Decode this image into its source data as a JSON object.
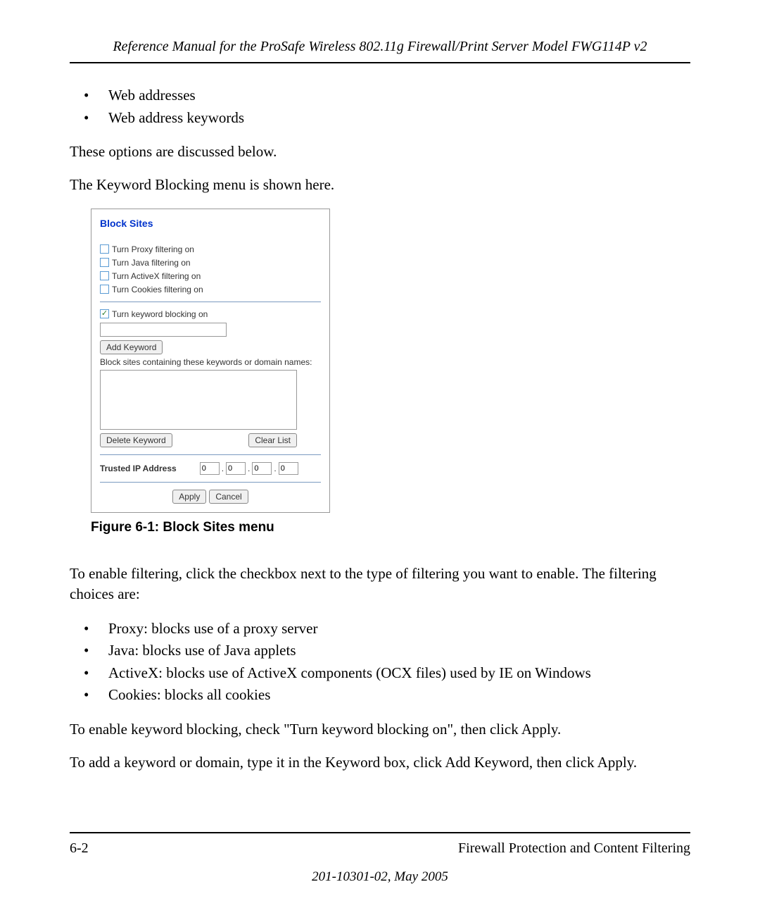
{
  "header": {
    "title": "Reference Manual for the ProSafe Wireless 802.11g  Firewall/Print Server Model FWG114P v2"
  },
  "list1": {
    "items": [
      "Web addresses",
      "Web address keywords"
    ]
  },
  "para1": "These options are discussed below.",
  "para2": "The Keyword Blocking menu is shown here.",
  "screenshot": {
    "title": "Block Sites",
    "checkboxes": {
      "proxy": "Turn Proxy filtering on",
      "java": "Turn Java filtering on",
      "activex": "Turn ActiveX filtering on",
      "cookies": "Turn Cookies filtering on",
      "keyword": "Turn keyword blocking on"
    },
    "add_keyword_btn": "Add Keyword",
    "block_sites_label": "Block sites containing these keywords or domain names:",
    "delete_keyword_btn": "Delete Keyword",
    "clear_list_btn": "Clear List",
    "trusted_label": "Trusted IP Address",
    "ip": {
      "a": "0",
      "b": "0",
      "c": "0",
      "d": "0"
    },
    "apply_btn": "Apply",
    "cancel_btn": "Cancel"
  },
  "figure_caption": "Figure 6-1:  Block Sites menu",
  "para3": "To enable filtering, click the checkbox next to the type of filtering you want to enable. The filtering choices are:",
  "list2": {
    "items": [
      "Proxy: blocks use of a proxy server",
      "Java: blocks use of Java applets",
      "ActiveX: blocks use of ActiveX components (OCX files) used by IE on Windows",
      "Cookies: blocks all cookies"
    ]
  },
  "para4": "To enable keyword blocking, check \"Turn keyword blocking on\", then click Apply.",
  "para5": "To add a keyword or domain, type it in the Keyword box, click Add Keyword, then click Apply.",
  "footer": {
    "page": "6-2",
    "section": "Firewall Protection and Content Filtering",
    "date": "201-10301-02, May 2005"
  }
}
